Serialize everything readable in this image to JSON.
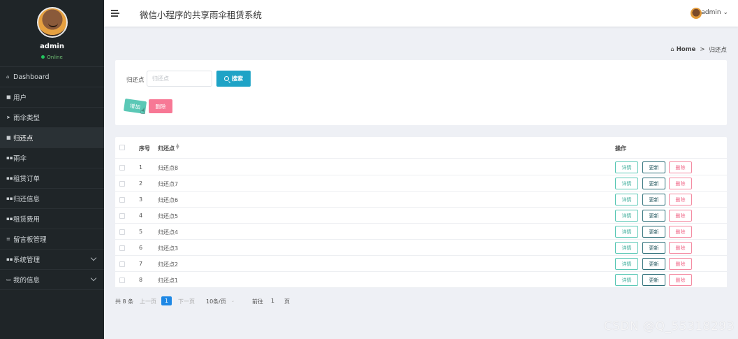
{
  "sidebar": {
    "user_name": "admin",
    "status": "Online",
    "items": [
      {
        "label": "Dashboard",
        "icon": "home-icon"
      },
      {
        "label": "用户",
        "icon": "user-icon"
      },
      {
        "label": "雨伞类型",
        "icon": "send-icon"
      },
      {
        "label": "归还点",
        "icon": "file-icon"
      },
      {
        "label": "雨伞",
        "icon": "grid-icon"
      },
      {
        "label": "租赁订单",
        "icon": "grid-icon"
      },
      {
        "label": "归还信息",
        "icon": "grid-icon"
      },
      {
        "label": "租赁费用",
        "icon": "grid-icon"
      },
      {
        "label": "留言板管理",
        "icon": "list-icon"
      },
      {
        "label": "系统管理",
        "icon": "grid-icon"
      },
      {
        "label": "我的信息",
        "icon": "card-icon"
      }
    ]
  },
  "topbar": {
    "title": "微信小程序的共享雨伞租赁系统",
    "user": "admin"
  },
  "breadcrumb": {
    "home": "Home",
    "separator": ">",
    "current": "归还点"
  },
  "search": {
    "label": "归还点",
    "placeholder": "归还点",
    "button": "搜索"
  },
  "actions": {
    "add": "增加",
    "delete": "删除"
  },
  "table": {
    "headers": {
      "index": "序号",
      "point": "归还点",
      "ops": "操作"
    },
    "rows": [
      {
        "index": "1",
        "point": "归还点8"
      },
      {
        "index": "2",
        "point": "归还点7"
      },
      {
        "index": "3",
        "point": "归还点6"
      },
      {
        "index": "4",
        "point": "归还点5"
      },
      {
        "index": "5",
        "point": "归还点4"
      },
      {
        "index": "6",
        "point": "归还点3"
      },
      {
        "index": "7",
        "point": "归还点2"
      },
      {
        "index": "8",
        "point": "归还点1"
      }
    ],
    "row_buttons": {
      "detail": "详情",
      "update": "更新",
      "delete": "删除"
    }
  },
  "pagination": {
    "total": "共 8 条",
    "prev": "上一页",
    "current": "1",
    "next": "下一页",
    "page_size": "10条/页",
    "goto": "前往",
    "goto_value": "1",
    "unit": "页"
  },
  "watermark": "CSDN @Q_55318293",
  "colors": {
    "sidebar_bg": "#1f2528",
    "search_button": "#1ea3c6",
    "add_button": "#5bc8b6",
    "delete_button": "#f77895",
    "page_current": "#1e88e5"
  }
}
